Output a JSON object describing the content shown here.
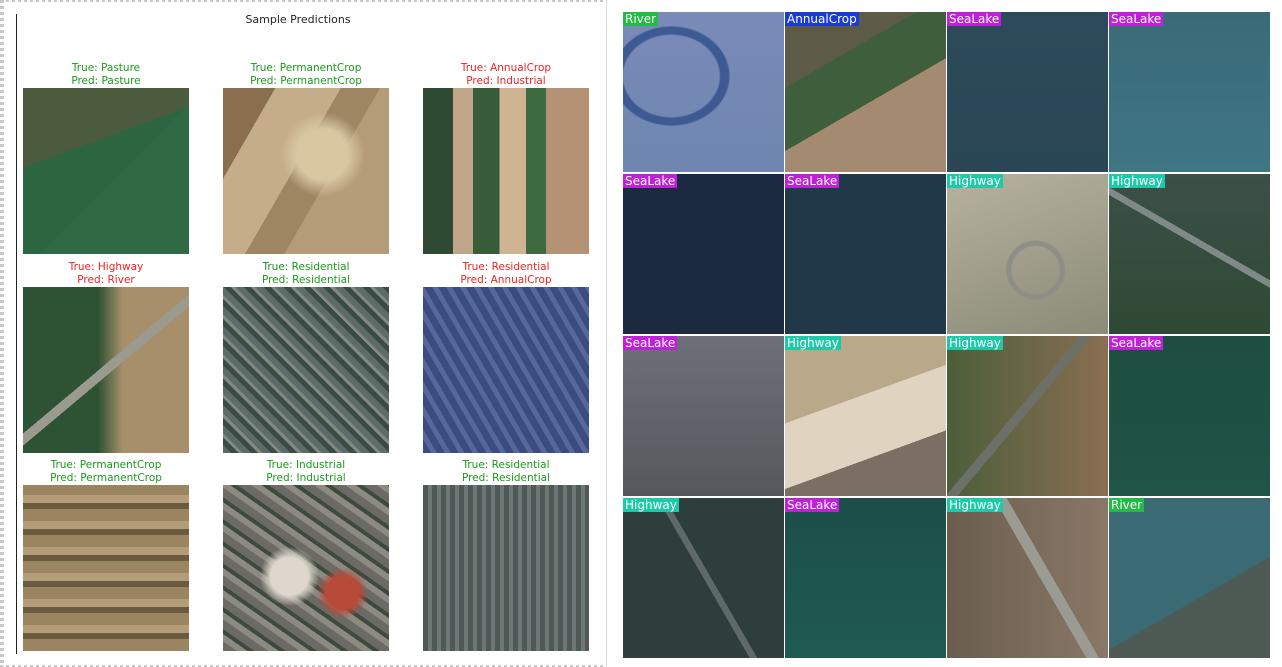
{
  "left_figure": {
    "title": "Sample Predictions",
    "cells": [
      {
        "true_label": "True: Pasture",
        "pred_label": "Pred: Pasture",
        "correct": true,
        "texture": "pasture"
      },
      {
        "true_label": "True: PermanentCrop",
        "pred_label": "Pred: PermanentCrop",
        "correct": true,
        "texture": "permcrop1"
      },
      {
        "true_label": "True: AnnualCrop",
        "pred_label": "Pred: Industrial",
        "correct": false,
        "texture": "annual"
      },
      {
        "true_label": "True: Highway",
        "pred_label": "Pred: River",
        "correct": false,
        "texture": "highway"
      },
      {
        "true_label": "True: Residential",
        "pred_label": "Pred: Residential",
        "correct": true,
        "texture": "resid"
      },
      {
        "true_label": "True: Residential",
        "pred_label": "Pred: AnnualCrop",
        "correct": false,
        "texture": "resid-blue"
      },
      {
        "true_label": "True: PermanentCrop",
        "pred_label": "Pred: PermanentCrop",
        "correct": true,
        "texture": "permcrop2"
      },
      {
        "true_label": "True: Industrial",
        "pred_label": "Pred: Industrial",
        "correct": true,
        "texture": "industrial"
      },
      {
        "true_label": "True: Residential",
        "pred_label": "Pred: Residential",
        "correct": true,
        "texture": "resid2"
      }
    ]
  },
  "right_grid": {
    "tiles": [
      {
        "label": "River",
        "tag_color": "#22bb44",
        "texture": "river"
      },
      {
        "label": "AnnualCrop",
        "tag_color": "#1a3ad8",
        "texture": "annual"
      },
      {
        "label": "SeaLake",
        "tag_color": "#c020d8",
        "texture": "sea1"
      },
      {
        "label": "SeaLake",
        "tag_color": "#c020d8",
        "texture": "sea2"
      },
      {
        "label": "SeaLake",
        "tag_color": "#c020d8",
        "texture": "sea3"
      },
      {
        "label": "SeaLake",
        "tag_color": "#c020d8",
        "texture": "sea4"
      },
      {
        "label": "Highway",
        "tag_color": "#1ec9a8",
        "texture": "hw1"
      },
      {
        "label": "Highway",
        "tag_color": "#1ec9a8",
        "texture": "hw2"
      },
      {
        "label": "SeaLake",
        "tag_color": "#c020d8",
        "texture": "sea5"
      },
      {
        "label": "Highway",
        "tag_color": "#1ec9a8",
        "texture": "hw3"
      },
      {
        "label": "Highway",
        "tag_color": "#1ec9a8",
        "texture": "hw4"
      },
      {
        "label": "SeaLake",
        "tag_color": "#c020d8",
        "texture": "sea6"
      },
      {
        "label": "Highway",
        "tag_color": "#1ec9a8",
        "texture": "hw5"
      },
      {
        "label": "SeaLake",
        "tag_color": "#c020d8",
        "texture": "sea7"
      },
      {
        "label": "Highway",
        "tag_color": "#1ec9a8",
        "texture": "hw6"
      },
      {
        "label": "River",
        "tag_color": "#22bb44",
        "texture": "river2"
      }
    ]
  }
}
